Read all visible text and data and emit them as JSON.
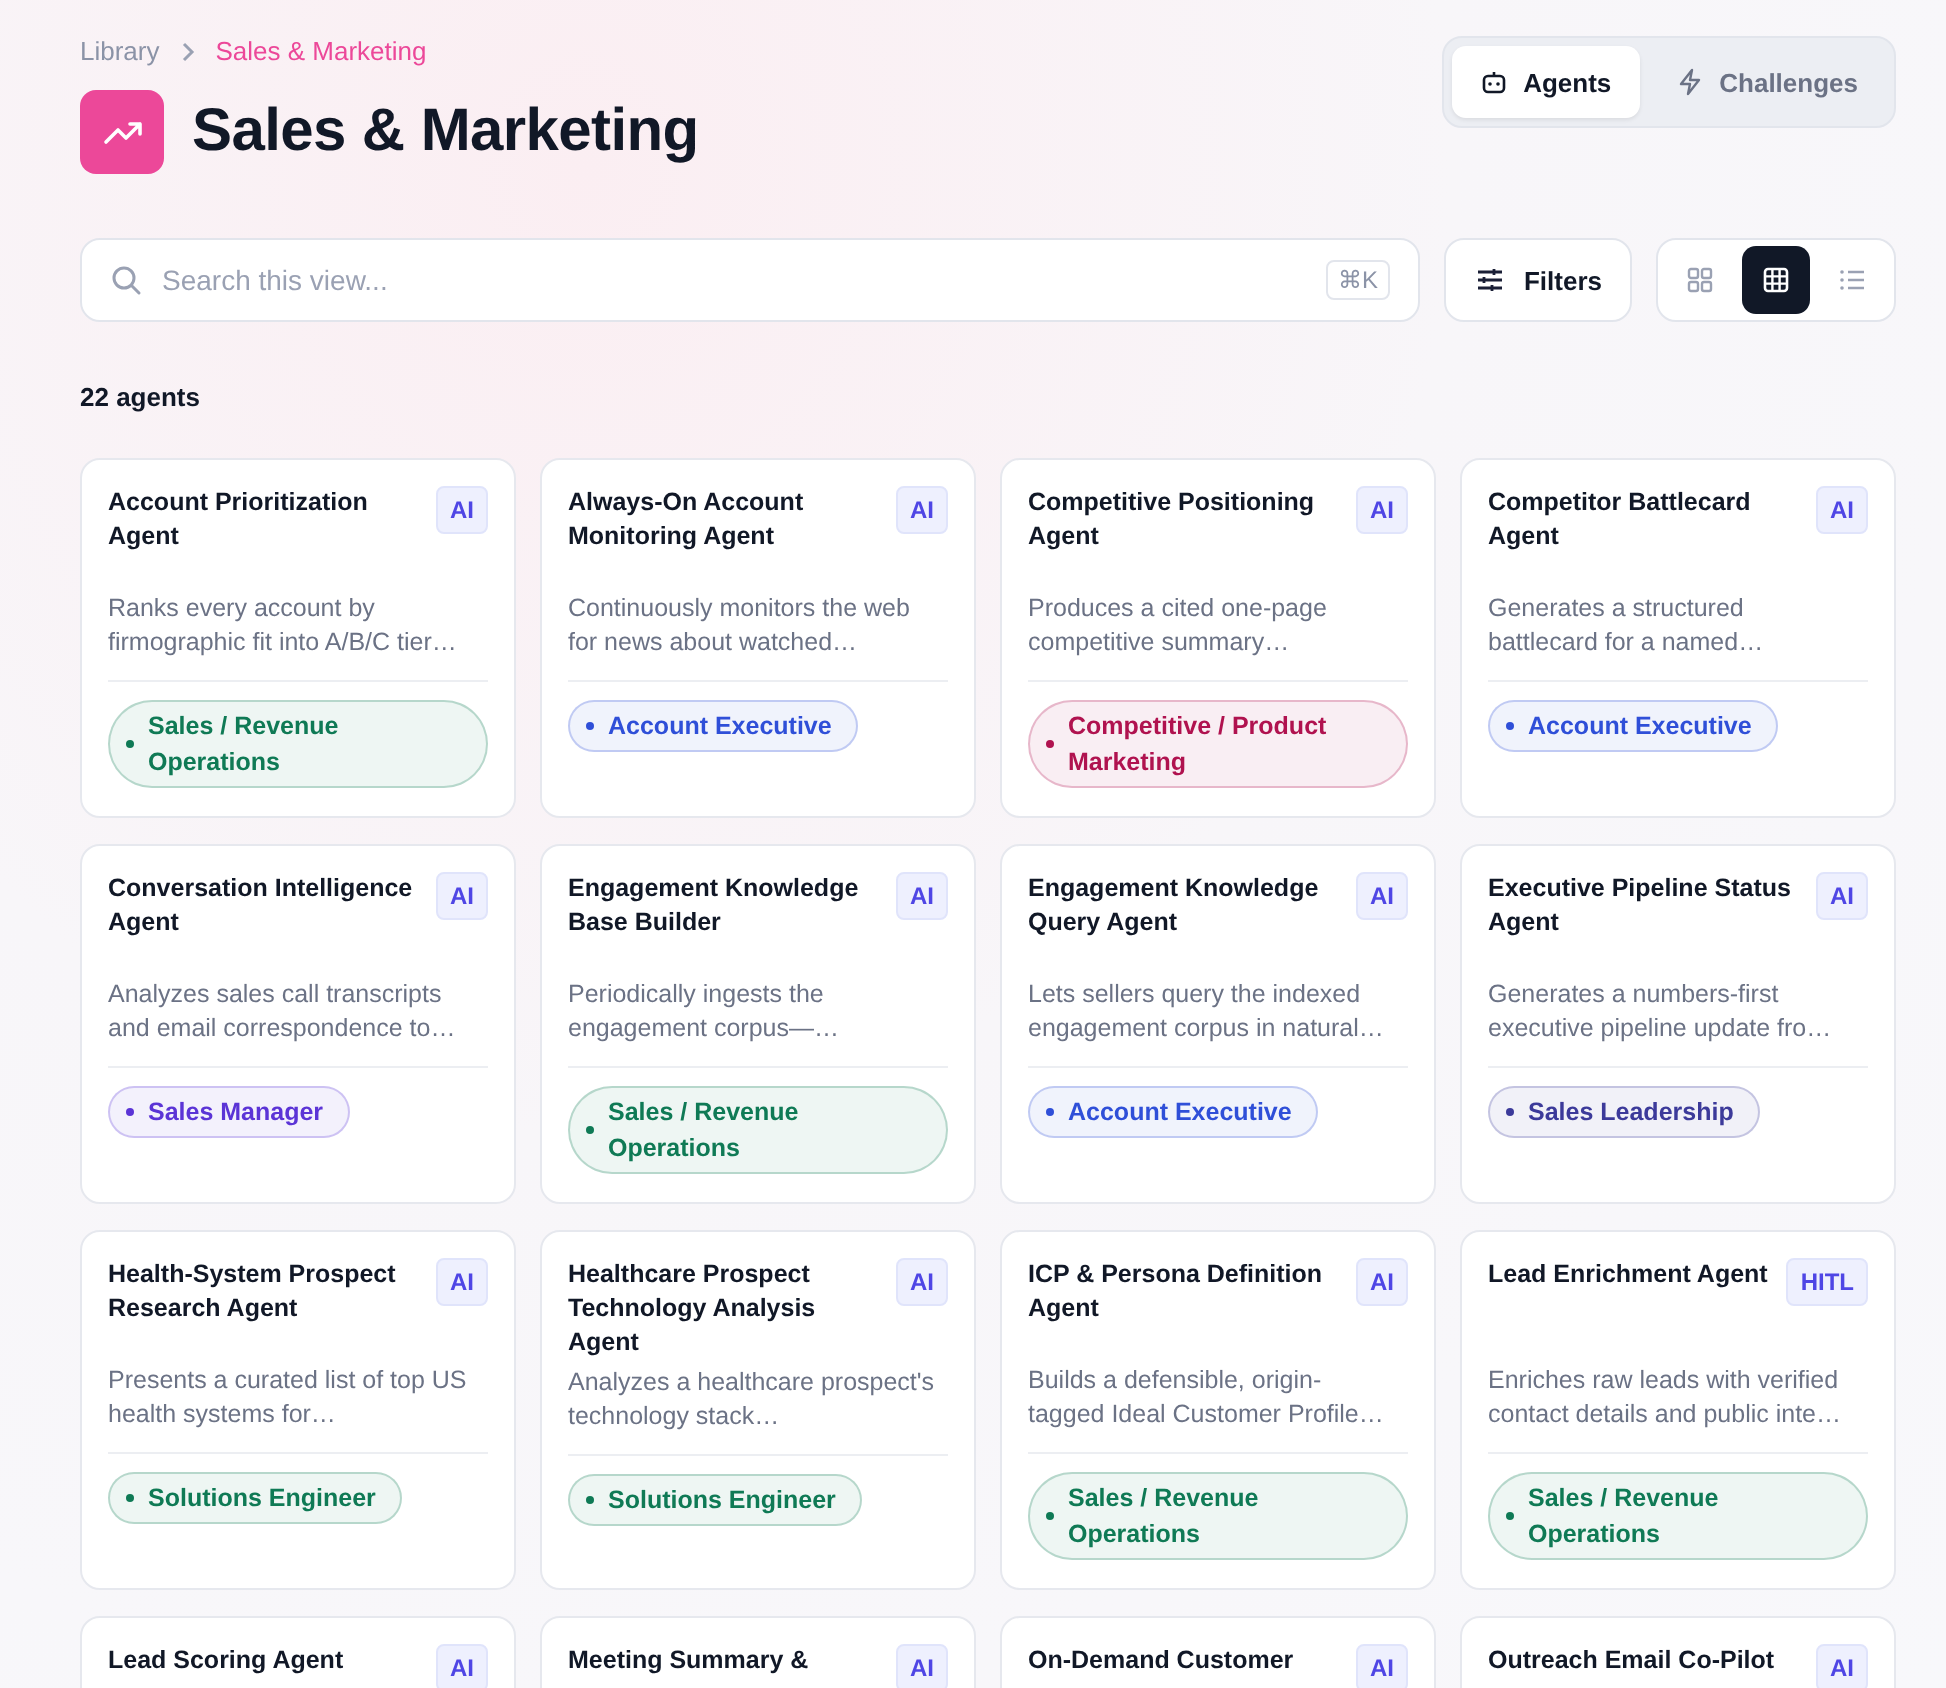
{
  "breadcrumb": [
    {
      "label": "Library",
      "current": false
    },
    {
      "label": "Sales & Marketing",
      "current": true
    }
  ],
  "page_title": "Sales & Marketing",
  "mode_tabs": [
    {
      "label": "Agents",
      "kind": "agents",
      "selected": true
    },
    {
      "label": "Challenges",
      "kind": "challenges",
      "selected": false
    }
  ],
  "search": {
    "placeholder": "Search this view...",
    "shortcut": "⌘K"
  },
  "filters_button": "Filters",
  "view_modes": [
    {
      "kind": "cards",
      "selected": false
    },
    {
      "kind": "grid",
      "selected": true
    },
    {
      "kind": "list",
      "selected": false
    }
  ],
  "count": "22 agents",
  "agents": [
    {
      "title": "Account Prioritization Agent",
      "badge": "AI",
      "description": "Ranks every account by firmographic fit into A/B/C tier…",
      "tag": {
        "label": "Sales / Revenue Operations",
        "color": "#0f7a55"
      }
    },
    {
      "title": "Always-On Account Monitoring Agent",
      "badge": "AI",
      "description": "Continuously monitors the web for news about watched…",
      "tag": {
        "label": "Account Executive",
        "color": "#2f4fd8"
      }
    },
    {
      "title": "Competitive Positioning Agent",
      "badge": "AI",
      "description": "Produces a cited one-page competitive summary…",
      "tag": {
        "label": "Competitive / Product Marketing",
        "color": "#b0124f"
      }
    },
    {
      "title": "Competitor Battlecard Agent",
      "badge": "AI",
      "description": "Generates a structured battlecard for a named…",
      "tag": {
        "label": "Account Executive",
        "color": "#2f4fd8"
      }
    },
    {
      "title": "Conversation Intelligence Agent",
      "badge": "AI",
      "description": "Analyzes sales call transcripts and email correspondence to…",
      "tag": {
        "label": "Sales Manager",
        "color": "#5b34d6"
      }
    },
    {
      "title": "Engagement Knowledge Base Builder",
      "badge": "AI",
      "description": "Periodically ingests the engagement corpus—…",
      "tag": {
        "label": "Sales / Revenue Operations",
        "color": "#0f7a55"
      }
    },
    {
      "title": "Engagement Knowledge Query Agent",
      "badge": "AI",
      "description": "Lets sellers query the indexed engagement corpus in natural…",
      "tag": {
        "label": "Account Executive",
        "color": "#2f4fd8"
      }
    },
    {
      "title": "Executive Pipeline Status Agent",
      "badge": "AI",
      "description": "Generates a numbers-first executive pipeline update fro…",
      "tag": {
        "label": "Sales Leadership",
        "color": "#3c3a9a"
      }
    },
    {
      "title": "Health-System Prospect Research Agent",
      "badge": "AI",
      "description": "Presents a curated list of top US health systems for…",
      "tag": {
        "label": "Solutions Engineer",
        "color": "#0f7a55"
      }
    },
    {
      "title": "Healthcare Prospect Technology Analysis Agent",
      "badge": "AI",
      "description": "Analyzes a healthcare prospect's technology stack…",
      "tag": {
        "label": "Solutions Engineer",
        "color": "#0f7a55"
      }
    },
    {
      "title": "ICP & Persona Definition Agent",
      "badge": "AI",
      "description": "Builds a defensible, origin-tagged Ideal Customer Profile…",
      "tag": {
        "label": "Sales / Revenue Operations",
        "color": "#0f7a55"
      }
    },
    {
      "title": "Lead Enrichment Agent",
      "badge": "HITL",
      "description": "Enriches raw leads with verified contact details and public inte…",
      "tag": {
        "label": "Sales / Revenue Operations",
        "color": "#0f7a55"
      }
    },
    {
      "title": "Lead Scoring Agent",
      "badge": "AI"
    },
    {
      "title": "Meeting Summary &",
      "badge": "AI"
    },
    {
      "title": "On-Demand Customer",
      "badge": "AI"
    },
    {
      "title": "Outreach Email Co-Pilot",
      "badge": "AI"
    }
  ]
}
